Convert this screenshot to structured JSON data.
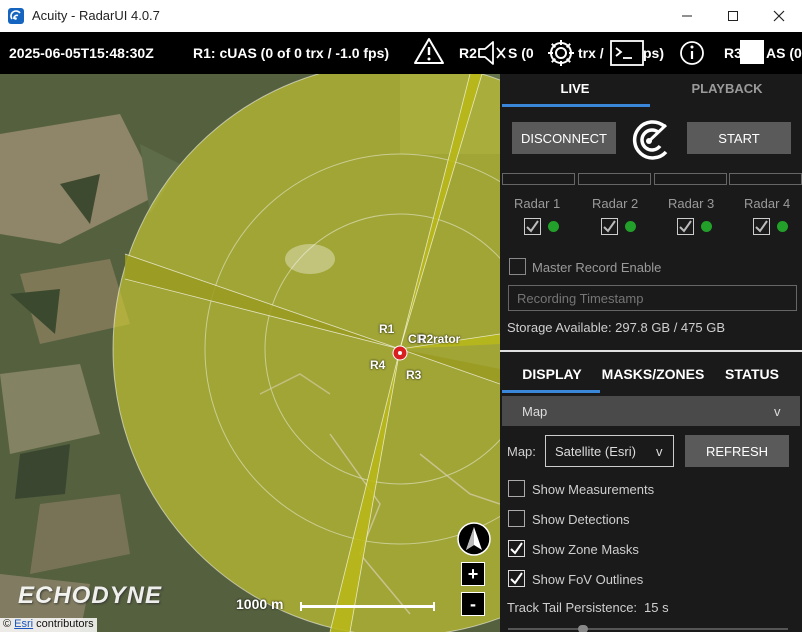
{
  "window": {
    "title": "Acuity - RadarUI 4.0.7",
    "minimize": "—",
    "maximize": "☐",
    "close": "✕"
  },
  "status": {
    "timestamp": "2025-06-05T15:48:30Z",
    "r1": "R1: cUAS  (0 of 0 trx / -1.0 fps)",
    "r2_prefix": "R2",
    "r2_obscured": "S  (0",
    "r2_rest": "trx /",
    "r2_end": "ps)",
    "r3_prefix": "R3",
    "r3_suffix": "AS  (0"
  },
  "map": {
    "labels": {
      "r1": "R1",
      "r2": "R2",
      "r3": "R3",
      "r4": "R4",
      "cr": "CR",
      "operator": "rator"
    },
    "scale_label": "1000 m",
    "brand": "ECHODYNE",
    "attribution_prefix": "©",
    "attribution_link": "Esri",
    "attribution_suffix": " contributors",
    "zoom_in": "+",
    "zoom_out": "-",
    "colors": {
      "coverage": "#d0d030",
      "beam": "#b8b81a"
    }
  },
  "panel": {
    "tabs": {
      "live": "LIVE",
      "playback": "PLAYBACK"
    },
    "disconnect": "DISCONNECT",
    "start": "START",
    "radars": [
      {
        "label": "Radar 1"
      },
      {
        "label": "Radar 2"
      },
      {
        "label": "Radar 3"
      },
      {
        "label": "Radar 4"
      }
    ],
    "master_record": "Master Record Enable",
    "recording_placeholder": "Recording Timestamp",
    "storage": "Storage Available: 297.8 GB / 475 GB",
    "lower_tabs": {
      "display": "DISPLAY",
      "masks": "MASKS/ZONES",
      "status": "STATUS"
    },
    "section": "Map",
    "section_chevron": "v",
    "map_label": "Map:",
    "map_value": "Satellite (Esri)",
    "map_chevron": "v",
    "refresh": "REFRESH",
    "options": [
      {
        "label": "Show Measurements",
        "checked": false
      },
      {
        "label": "Show Detections",
        "checked": false
      },
      {
        "label": "Show Zone Masks",
        "checked": true
      },
      {
        "label": "Show FoV Outlines",
        "checked": true
      }
    ],
    "tail_label": "Track Tail Persistence:",
    "tail_value": "15 s",
    "accent": "#3a86d8"
  }
}
